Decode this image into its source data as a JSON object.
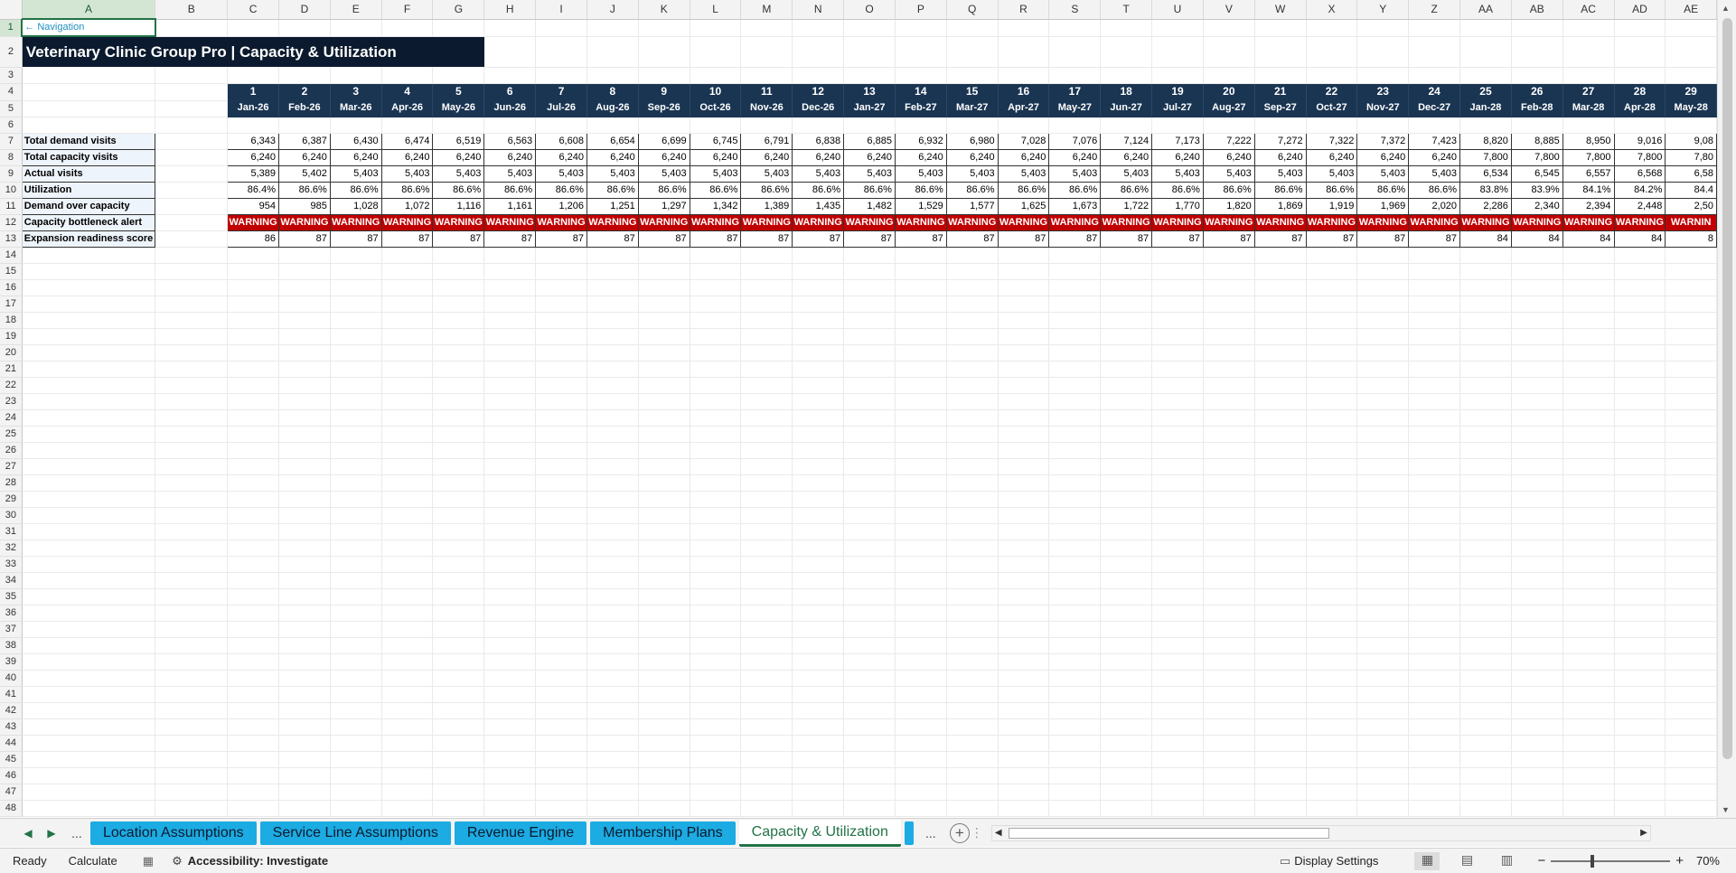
{
  "grid": {
    "columns": [
      "A",
      "B",
      "C",
      "D",
      "E",
      "F",
      "G",
      "H",
      "I",
      "J",
      "K",
      "L",
      "M",
      "N",
      "O",
      "P",
      "Q",
      "R",
      "S",
      "T",
      "U",
      "V",
      "W",
      "X",
      "Y",
      "Z",
      "AA",
      "AB",
      "AC",
      "AD",
      "AE"
    ],
    "row_numbers": [
      "1",
      "2",
      "3",
      "4",
      "5",
      "6",
      "7",
      "8",
      "9",
      "10",
      "11",
      "12",
      "13",
      "14",
      "15",
      "16",
      "17",
      "18",
      "19",
      "20",
      "21",
      "22",
      "23",
      "24",
      "25",
      "26",
      "27",
      "28",
      "29",
      "30",
      "31",
      "32",
      "33",
      "34",
      "35",
      "36",
      "37",
      "38",
      "39",
      "40",
      "41",
      "42",
      "43",
      "44",
      "45",
      "46",
      "47",
      "48"
    ],
    "nav_link": "← Navigation",
    "title": "Veterinary Clinic Group Pro | Capacity & Utilization",
    "period_numbers": [
      "1",
      "2",
      "3",
      "4",
      "5",
      "6",
      "7",
      "8",
      "9",
      "10",
      "11",
      "12",
      "13",
      "14",
      "15",
      "16",
      "17",
      "18",
      "19",
      "20",
      "21",
      "22",
      "23",
      "24",
      "25",
      "26",
      "27",
      "28",
      "29"
    ],
    "period_months": [
      "Jan-26",
      "Feb-26",
      "Mar-26",
      "Apr-26",
      "May-26",
      "Jun-26",
      "Jul-26",
      "Aug-26",
      "Sep-26",
      "Oct-26",
      "Nov-26",
      "Dec-26",
      "Jan-27",
      "Feb-27",
      "Mar-27",
      "Apr-27",
      "May-27",
      "Jun-27",
      "Jul-27",
      "Aug-27",
      "Sep-27",
      "Oct-27",
      "Nov-27",
      "Dec-27",
      "Jan-28",
      "Feb-28",
      "Mar-28",
      "Apr-28",
      "May-28"
    ],
    "rows": [
      {
        "label": "Total demand visits",
        "values": [
          "6,343",
          "6,387",
          "6,430",
          "6,474",
          "6,519",
          "6,563",
          "6,608",
          "6,654",
          "6,699",
          "6,745",
          "6,791",
          "6,838",
          "6,885",
          "6,932",
          "6,980",
          "7,028",
          "7,076",
          "7,124",
          "7,173",
          "7,222",
          "7,272",
          "7,322",
          "7,372",
          "7,423",
          "8,820",
          "8,885",
          "8,950",
          "9,016",
          "9,08"
        ]
      },
      {
        "label": "Total capacity visits",
        "values": [
          "6,240",
          "6,240",
          "6,240",
          "6,240",
          "6,240",
          "6,240",
          "6,240",
          "6,240",
          "6,240",
          "6,240",
          "6,240",
          "6,240",
          "6,240",
          "6,240",
          "6,240",
          "6,240",
          "6,240",
          "6,240",
          "6,240",
          "6,240",
          "6,240",
          "6,240",
          "6,240",
          "6,240",
          "7,800",
          "7,800",
          "7,800",
          "7,800",
          "7,80"
        ]
      },
      {
        "label": "Actual visits",
        "values": [
          "5,389",
          "5,402",
          "5,403",
          "5,403",
          "5,403",
          "5,403",
          "5,403",
          "5,403",
          "5,403",
          "5,403",
          "5,403",
          "5,403",
          "5,403",
          "5,403",
          "5,403",
          "5,403",
          "5,403",
          "5,403",
          "5,403",
          "5,403",
          "5,403",
          "5,403",
          "5,403",
          "5,403",
          "6,534",
          "6,545",
          "6,557",
          "6,568",
          "6,58"
        ]
      },
      {
        "label": "Utilization",
        "values": [
          "86.4%",
          "86.6%",
          "86.6%",
          "86.6%",
          "86.6%",
          "86.6%",
          "86.6%",
          "86.6%",
          "86.6%",
          "86.6%",
          "86.6%",
          "86.6%",
          "86.6%",
          "86.6%",
          "86.6%",
          "86.6%",
          "86.6%",
          "86.6%",
          "86.6%",
          "86.6%",
          "86.6%",
          "86.6%",
          "86.6%",
          "86.6%",
          "83.8%",
          "83.9%",
          "84.1%",
          "84.2%",
          "84.4"
        ]
      },
      {
        "label": "Demand over capacity",
        "values": [
          "954",
          "985",
          "1,028",
          "1,072",
          "1,116",
          "1,161",
          "1,206",
          "1,251",
          "1,297",
          "1,342",
          "1,389",
          "1,435",
          "1,482",
          "1,529",
          "1,577",
          "1,625",
          "1,673",
          "1,722",
          "1,770",
          "1,820",
          "1,869",
          "1,919",
          "1,969",
          "2,020",
          "2,286",
          "2,340",
          "2,394",
          "2,448",
          "2,50"
        ]
      },
      {
        "label": "Capacity bottleneck alert",
        "values": [
          "WARNING",
          "WARNING",
          "WARNING",
          "WARNING",
          "WARNING",
          "WARNING",
          "WARNING",
          "WARNING",
          "WARNING",
          "WARNING",
          "WARNING",
          "WARNING",
          "WARNING",
          "WARNING",
          "WARNING",
          "WARNING",
          "WARNING",
          "WARNING",
          "WARNING",
          "WARNING",
          "WARNING",
          "WARNING",
          "WARNING",
          "WARNING",
          "WARNING",
          "WARNING",
          "WARNING",
          "WARNING",
          "WARNIN"
        ]
      },
      {
        "label": "Expansion readiness score",
        "values": [
          "86",
          "87",
          "87",
          "87",
          "87",
          "87",
          "87",
          "87",
          "87",
          "87",
          "87",
          "87",
          "87",
          "87",
          "87",
          "87",
          "87",
          "87",
          "87",
          "87",
          "87",
          "87",
          "87",
          "87",
          "84",
          "84",
          "84",
          "84",
          "8"
        ]
      }
    ]
  },
  "tabs": {
    "nav_prev": "◀",
    "nav_next": "▶",
    "more_left": "...",
    "items": [
      "Location Assumptions",
      "Service Line Assumptions",
      "Revenue Engine",
      "Membership Plans",
      "Capacity & Utilization"
    ],
    "active_index": 4,
    "more_right": "...",
    "add": "+"
  },
  "status": {
    "ready": "Ready",
    "calculate": "Calculate",
    "accessibility": "Accessibility: Investigate",
    "display_settings": "Display Settings",
    "zoom_minus": "−",
    "zoom_plus": "+",
    "zoom": "70%",
    "zoom_level": 0.7
  },
  "colors": {
    "title_bg": "#0b1a2e",
    "header_bg": "#1a3552",
    "warning_bg": "#c00000",
    "tab_bg": "#1cabe2",
    "excel_green": "#217346"
  }
}
